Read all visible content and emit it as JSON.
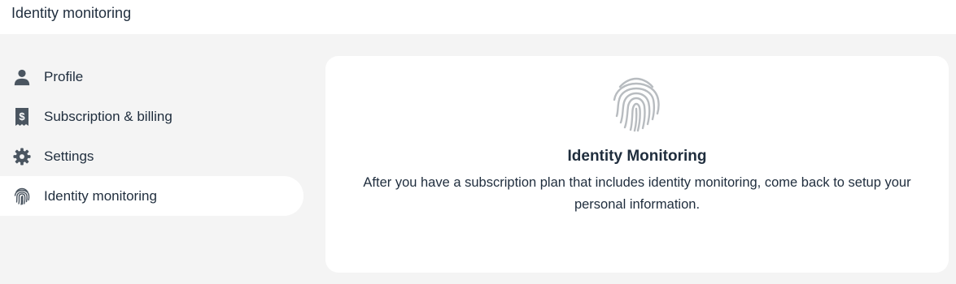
{
  "header": {
    "title": "Identity monitoring"
  },
  "sidebar": {
    "items": [
      {
        "label": "Profile",
        "icon": "person-icon"
      },
      {
        "label": "Subscription & billing",
        "icon": "receipt-dollar-icon"
      },
      {
        "label": "Settings",
        "icon": "gear-icon"
      },
      {
        "label": "Identity monitoring",
        "icon": "fingerprint-icon",
        "active": true
      }
    ]
  },
  "main": {
    "icon": "fingerprint-icon",
    "heading": "Identity Monitoring",
    "description": "After you have a subscription plan that includes identity monitoring, come back to setup your personal information."
  },
  "colors": {
    "background": "#f4f4f4",
    "surface": "#ffffff",
    "text": "#1f2d3d",
    "icon": "#4a5560",
    "fingerprint_light": "#b8bcc0"
  }
}
